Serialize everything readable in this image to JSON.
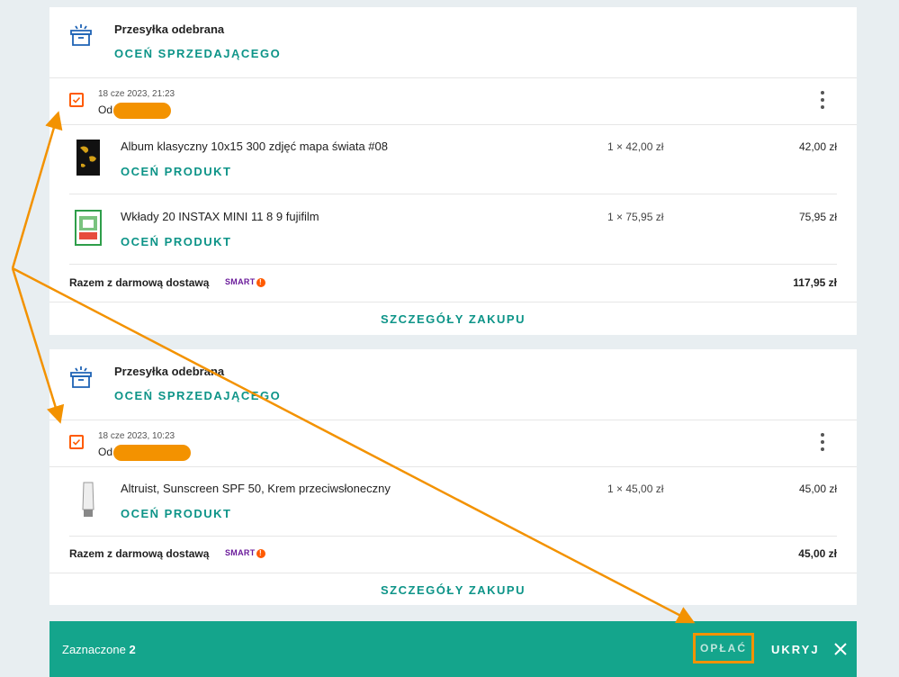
{
  "colors": {
    "accent": "#0d9488",
    "checkbox": "#ff5a00",
    "bar": "#14a58c",
    "annotation": "#f39200",
    "smart": "#6a1b9a"
  },
  "orders": [
    {
      "shipment_status": "Przesyłka odebrana",
      "rate_seller": "OCEŃ SPRZEDAJĄCEGO",
      "date": "18 cze 2023, 21:23",
      "from_label": "Od",
      "items": [
        {
          "name": "Album klasyczny 10x15 300 zdjęć mapa świata #08",
          "qty": "1 × 42,00 zł",
          "price": "42,00 zł",
          "rate_label": "OCEŃ PRODUKT",
          "icon": "photo-album-icon"
        },
        {
          "name": "Wkłady 20 INSTAX MINI 11 8 9 fujifilm",
          "qty": "1 × 75,95 zł",
          "price": "75,95 zł",
          "rate_label": "OCEŃ PRODUKT",
          "icon": "instax-film-icon"
        }
      ],
      "total_label": "Razem z darmową dostawą",
      "smart_label": "SMART",
      "total": "117,95 zł",
      "details_label": "SZCZEGÓŁY ZAKUPU"
    },
    {
      "shipment_status": "Przesyłka odebrana",
      "rate_seller": "OCEŃ SPRZEDAJĄCEGO",
      "date": "18 cze 2023, 10:23",
      "from_label": "Od",
      "items": [
        {
          "name": "Altruist, Sunscreen SPF 50, Krem przeciwsłoneczny",
          "qty": "1 × 45,00 zł",
          "price": "45,00 zł",
          "rate_label": "OCEŃ PRODUKT",
          "icon": "sunscreen-tube-icon"
        }
      ],
      "total_label": "Razem z darmową dostawą",
      "smart_label": "SMART",
      "total": "45,00 zł",
      "details_label": "SZCZEGÓŁY ZAKUPU"
    }
  ],
  "bottom_bar": {
    "selected_label": "Zaznaczone",
    "selected_count": "2",
    "pay_label": "OPŁAĆ",
    "hide_label": "UKRYJ"
  }
}
